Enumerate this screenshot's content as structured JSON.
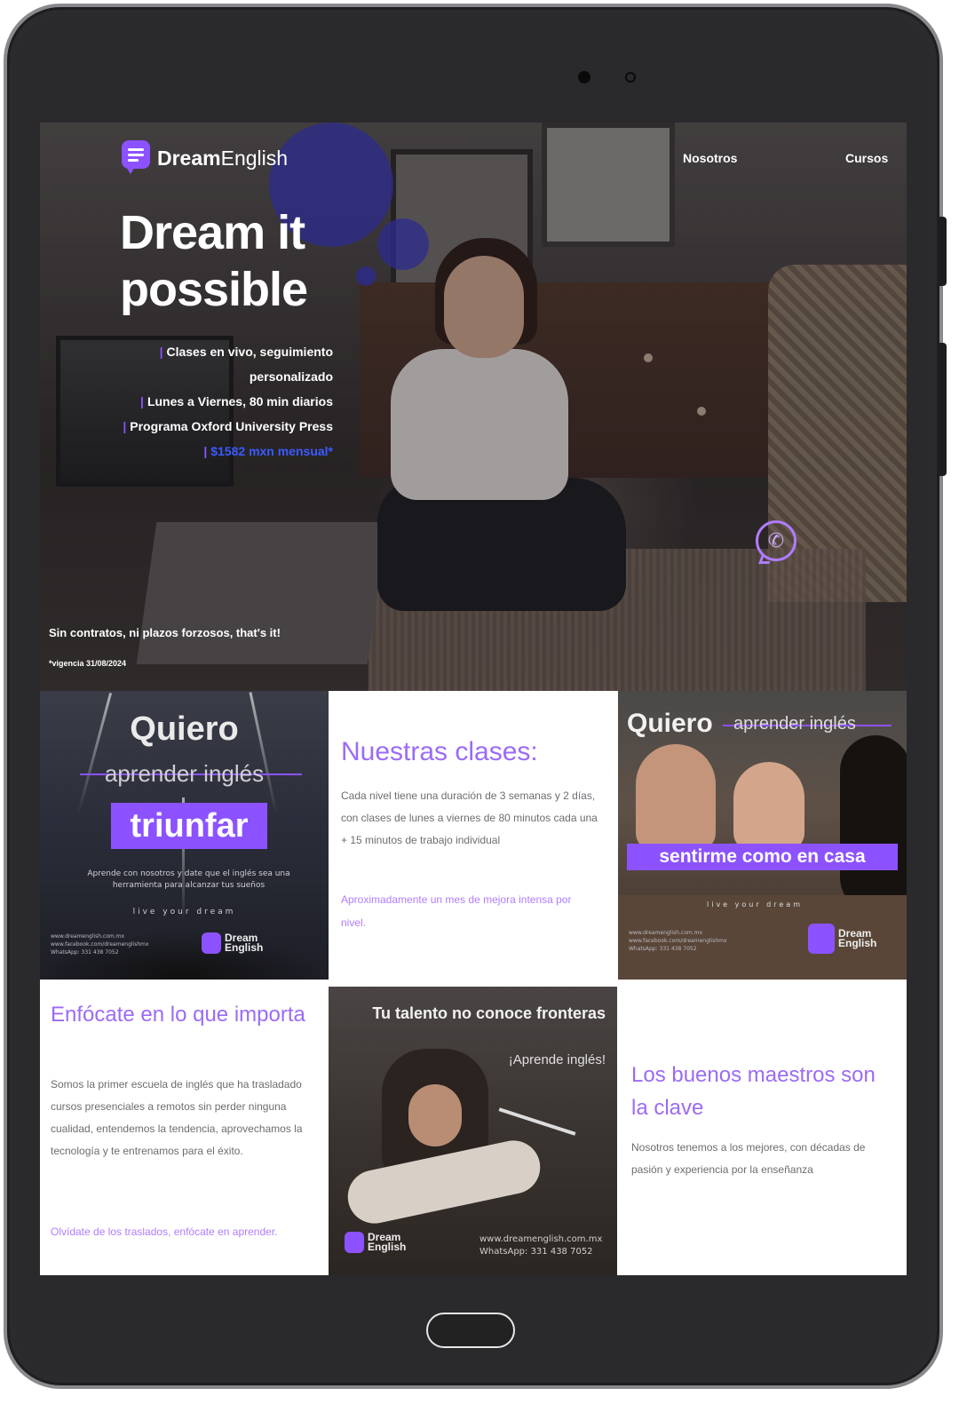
{
  "brand": {
    "name_bold": "Dream",
    "name_light": "English"
  },
  "nav": [
    "Nosotros",
    "Cursos"
  ],
  "hero": {
    "headline": "Dream it possible",
    "features": [
      "Clases en vivo, seguimiento personalizado",
      "Lunes a Viernes, 80 min diarios",
      "Programa Oxford University Press"
    ],
    "price": "$1582 mxn mensual*",
    "no_contracts": "Sin contratos, ni plazos forzosos, that's it!",
    "vigencia": "*vigencia 31/08/2024"
  },
  "tile_triunfar": {
    "quiero": "Quiero",
    "aprender": "aprender inglés",
    "badge": "triunfar",
    "copy": "Aprende con nosotros y date que el inglés sea una herramienta para alcanzar tus sueños",
    "tagline": "live your dream",
    "contact": "www.dreamenglish.com.mx\nwww.facebook.com/dreamenglishmx\nWhatsApp: 331 438 7052",
    "logo": "Dream English"
  },
  "clases": {
    "title": "Nuestras clases:",
    "body": "Cada nivel tiene una duración de 3 semanas y 2 días, con clases de lunes a viernes de 80 minutos cada una + 15 minutos de trabajo individual",
    "link": "Aproximadamente un mes de mejora intensa por nivel."
  },
  "tile_casa": {
    "quiero": "Quiero",
    "aprender": "aprender inglés",
    "badge": "sentirme como en casa",
    "tagline": "live your dream",
    "contact": "www.dreamenglish.com.mx\nwww.facebook.com/dreamenglishmx\nWhatsApp: 331 438 7052",
    "logo": "Dream English"
  },
  "enfocate": {
    "title": "Enfócate en lo que importa",
    "body": "Somos la primer escuela de inglés que ha trasladado cursos presenciales a remotos sin perder ninguna cualidad, entendemos la tendencia, aprovechamos la tecnología y te entrenamos para el éxito.",
    "link": "Olvídate de los traslados, enfócate en aprender."
  },
  "tile_talento": {
    "title": "Tu talento no conoce fronteras",
    "sub": "¡Aprende inglés!",
    "contact": "www.dreamenglish.com.mx\nWhatsApp: 331 438 7052",
    "logo": "Dream English"
  },
  "maestros": {
    "title": "Los buenos maestros son la clave",
    "body": "Nosotros tenemos a los mejores, con décadas de pasión y experiencia por la enseñanza"
  },
  "colors": {
    "accent": "#8c52ff",
    "heading": "#9b6bf5",
    "link": "#b07cff",
    "price": "#3a5bff"
  }
}
